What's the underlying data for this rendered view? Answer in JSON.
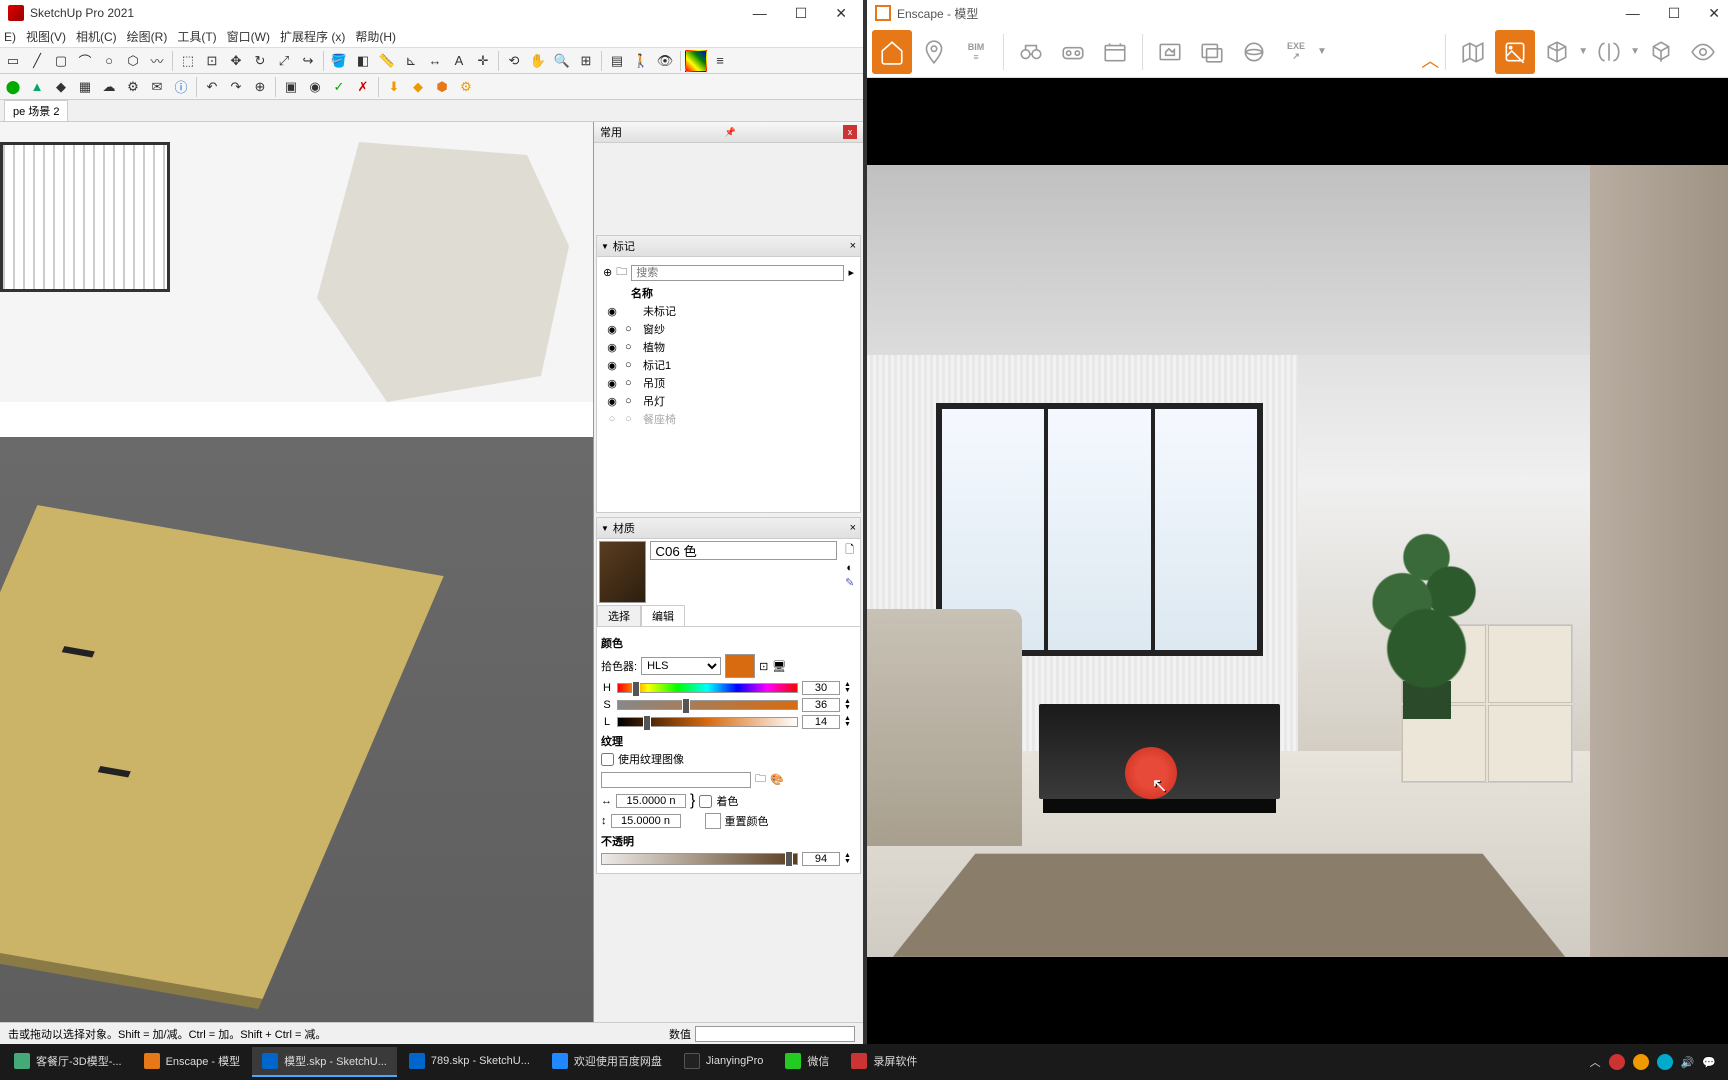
{
  "sketchup": {
    "title": "SketchUp Pro 2021",
    "menus": [
      "E)",
      "视图(V)",
      "相机(C)",
      "绘图(R)",
      "工具(T)",
      "窗口(W)",
      "扩展程序 (x)",
      "帮助(H)"
    ],
    "scene_tab": "pe 场景 2",
    "status": "击或拖动以选择对象。Shift = 加/减。Ctrl = 加。Shift + Ctrl = 减。",
    "vcb_label": "数值",
    "trays": {
      "title": "常用",
      "tags": {
        "header": "标记",
        "search_placeholder": "搜索",
        "col_name": "名称",
        "items": [
          "未标记",
          "窗纱",
          "植物",
          "标记1",
          "吊顶",
          "吊灯",
          "餐座椅"
        ]
      },
      "materials": {
        "header": "材质",
        "name": "C06 色",
        "tab_select": "选择",
        "tab_edit": "编辑",
        "color_label": "颜色",
        "picker_label": "拾色器:",
        "picker_mode": "HLS",
        "h_label": "H",
        "h_val": "30",
        "s_label": "S",
        "s_val": "36",
        "l_label": "L",
        "l_val": "14",
        "texture_label": "纹理",
        "use_texture": "使用纹理图像",
        "dim1": "15.0000 n",
        "dim2": "15.0000 n",
        "colorize": "着色",
        "reset_color": "重置颜色",
        "opacity_label": "不透明",
        "opacity_val": "94"
      }
    }
  },
  "enscape": {
    "title": "Enscape - 模型",
    "bim_label": "BIM"
  },
  "taskbar": {
    "items": [
      {
        "label": "客餐厅-3D模型-...",
        "color": "#4a7"
      },
      {
        "label": "Enscape - 模型",
        "color": "#e67817"
      },
      {
        "label": "模型.skp - SketchU...",
        "color": "#06c"
      },
      {
        "label": "789.skp - SketchU...",
        "color": "#06c"
      },
      {
        "label": "欢迎使用百度网盘",
        "color": "#28f"
      },
      {
        "label": "JianyingPro",
        "color": "#222"
      },
      {
        "label": "微信",
        "color": "#2c2"
      },
      {
        "label": "录屏软件",
        "color": "#c33"
      }
    ]
  }
}
